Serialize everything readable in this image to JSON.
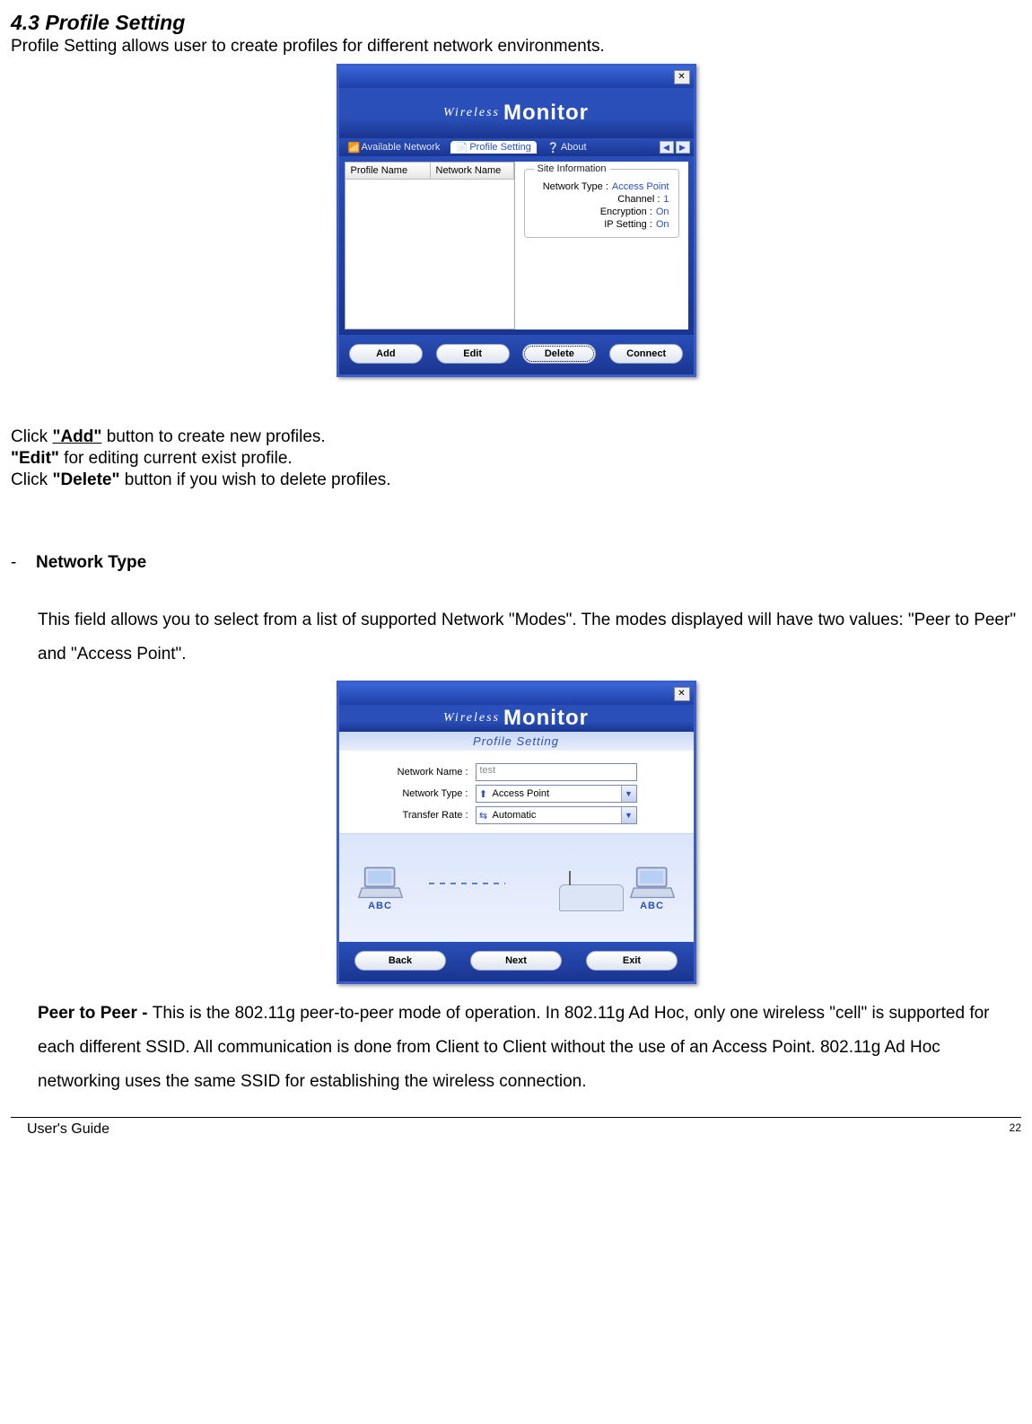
{
  "section": {
    "number_title": "4.3 Profile Setting",
    "intro": "Profile Setting allows user to create profiles for different network environments."
  },
  "app": {
    "brand_small": "Wireless",
    "brand_big": "Monitor",
    "tabs": {
      "available": "Available Network",
      "profile": "Profile Setting",
      "about": "About"
    },
    "profile_list": {
      "col_profile": "Profile Name",
      "col_network": "Network Name"
    },
    "site_info": {
      "legend": "Site Information",
      "rows": [
        {
          "label": "Network Type :",
          "value": "Access Point"
        },
        {
          "label": "Channel :",
          "value": "1"
        },
        {
          "label": "Encryption :",
          "value": "On"
        },
        {
          "label": "IP Setting :",
          "value": "On"
        }
      ]
    },
    "buttons": {
      "add": "Add",
      "edit": "Edit",
      "delete": "Delete",
      "connect": "Connect"
    }
  },
  "instructions": {
    "add_pre": "Click ",
    "add_bold": "\"Add\"",
    "add_post": " button to create new profiles.",
    "edit_bold": "\"Edit\"",
    "edit_post": " for editing current exist profile.",
    "del_pre": "Click ",
    "del_bold": "\"Delete\"",
    "del_post": " button if you wish to delete profiles."
  },
  "network_type": {
    "heading": "Network Type",
    "desc": "This field allows you to select from a list of supported Network \"Modes\".  The modes displayed will have two values:  \"Peer to Peer\" and \"Access Point\"."
  },
  "app2": {
    "subtitle": "Profile Setting",
    "form": {
      "name_label": "Network Name :",
      "name_value": "test",
      "type_label": "Network Type :",
      "type_value": "Access Point",
      "rate_label": "Transfer Rate :",
      "rate_value": "Automatic"
    },
    "illus_label": "ABC",
    "buttons": {
      "back": "Back",
      "next": "Next",
      "exit": "Exit"
    }
  },
  "peer": {
    "label": " Peer to Peer   - ",
    "text": "This is the 802.11g peer-to-peer mode of operation.  In 802.11g Ad Hoc, only one wireless \"cell\" is supported for each different SSID.  All communication is done from Client to Client without the use of an Access Point. 802.11g  Ad Hoc networking uses the same SSID for establishing the wireless connection."
  },
  "footer": {
    "guide": "User's Guide",
    "page": "22"
  }
}
